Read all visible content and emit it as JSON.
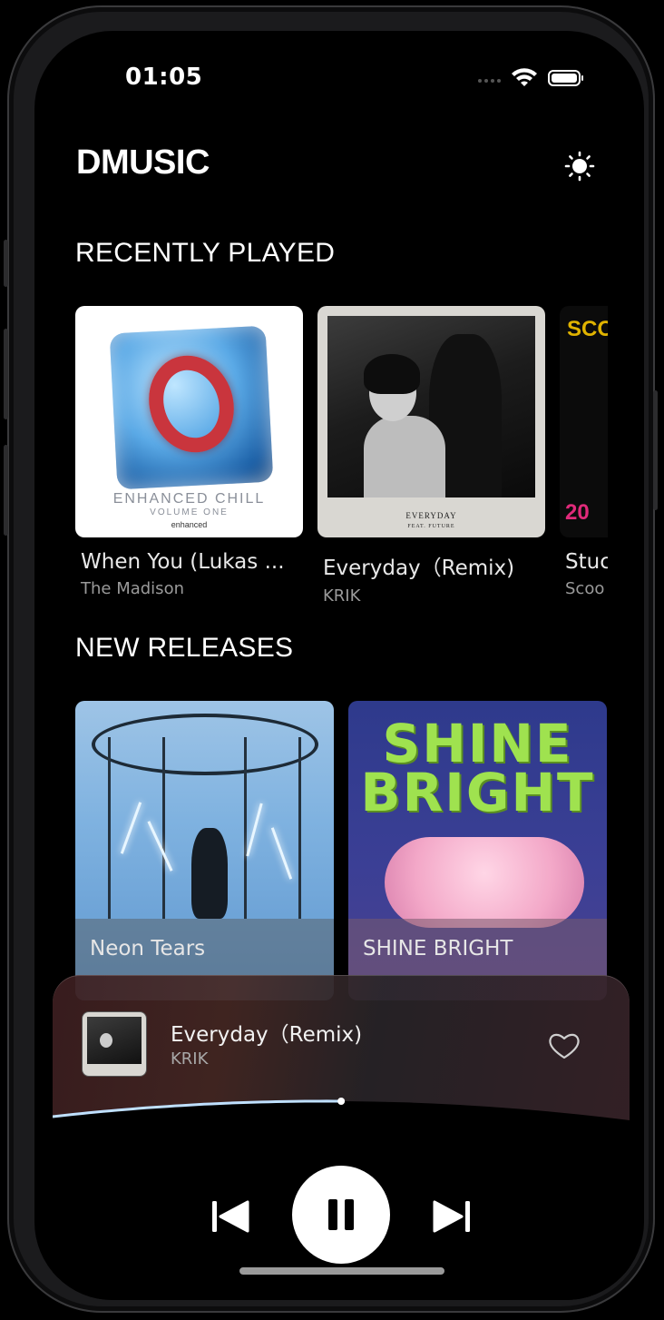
{
  "status_bar": {
    "time": "01:05"
  },
  "header": {
    "title": "DMUSIC",
    "theme_icon": "sun-icon"
  },
  "recently_played": {
    "title": "RECENTLY PLAYED",
    "items": [
      {
        "title": "When You (Lukas ...",
        "artist": "The Madison",
        "art_text_1": "ENHANCED CHILL",
        "art_text_2": "VOLUME ONE",
        "art_text_3": "enhanced"
      },
      {
        "title": "Everyday（Remix)",
        "artist": "KRIK",
        "art_text_1": "EVERYDAY",
        "art_text_2": "FEAT. FUTURE"
      },
      {
        "title": "Stuc",
        "artist": "Scoo",
        "art_text_1": "SCO",
        "art_text_2": "20"
      }
    ]
  },
  "new_releases": {
    "title": "NEW RELEASES",
    "items": [
      {
        "title": "Neon Tears"
      },
      {
        "title": "SHINE BRIGHT",
        "art_text": "SHINE BRIGHT"
      }
    ]
  },
  "player": {
    "title": "Everyday（Remix)",
    "artist": "KRIK",
    "progress": 0.5,
    "icons": {
      "like": "heart-icon",
      "prev": "skip-previous-icon",
      "play_pause": "pause-icon",
      "next": "skip-next-icon"
    },
    "colors": {
      "progress": "#bfe0ff"
    }
  }
}
